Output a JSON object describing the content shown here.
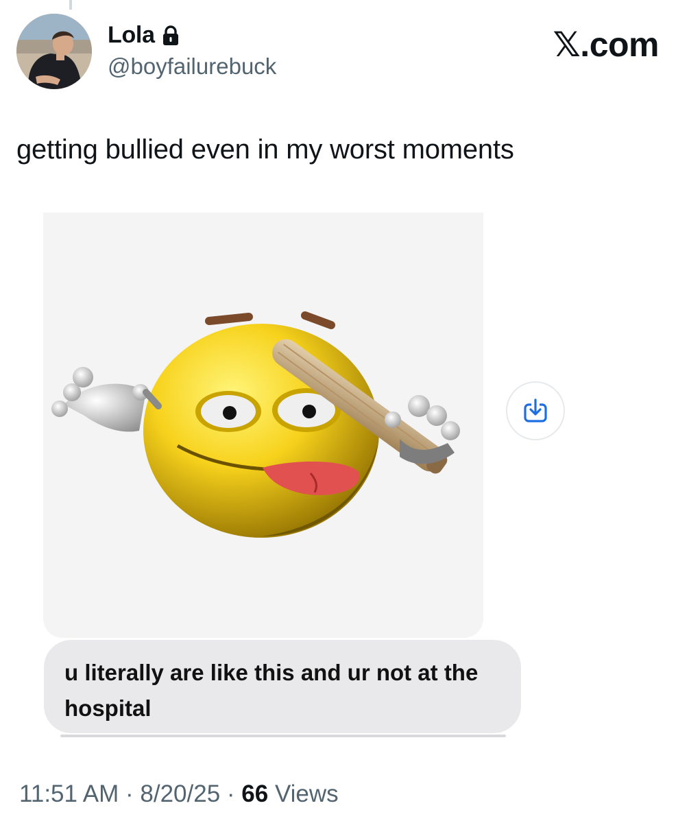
{
  "author": {
    "display_name": "Lola",
    "handle": "@boyfailurebuck",
    "protected_icon": "lock-icon"
  },
  "brand": {
    "prefix": "𝕏",
    "suffix": ".com"
  },
  "tweet": {
    "text": "getting bullied even in my worst moments",
    "message_bubble": "u literally are like this and ur not at the hospital"
  },
  "icons": {
    "save_button": "download-icon",
    "save_color": "#1d6ee3"
  },
  "meta": {
    "time": "11:51 AM",
    "sep1": " · ",
    "date": "8/20/25",
    "sep2": " · ",
    "views_count": "66",
    "views_label": " Views"
  },
  "colors": {
    "secondary_text": "#536471",
    "bubble": "#e9e9eb",
    "emoji_yellow": "#f7d21c"
  }
}
